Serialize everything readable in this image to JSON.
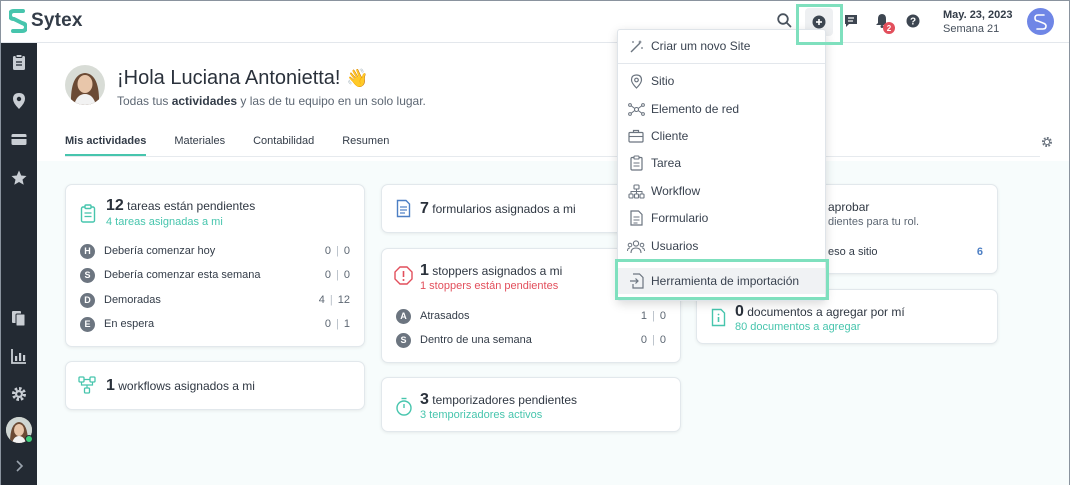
{
  "app": {
    "name": "Sytex"
  },
  "header": {
    "date": "May. 23, 2023",
    "week": "Semana 21",
    "notification_count": "2"
  },
  "greeting": {
    "title": "¡Hola Luciana Antonietta!",
    "emoji": "👋",
    "sub_prefix": "Todas tus ",
    "sub_bold": "actividades",
    "sub_suffix": " y las de tu equipo en un solo lugar."
  },
  "tabs": [
    "Mis actividades",
    "Materiales",
    "Contabilidad",
    "Resumen"
  ],
  "tasks_card": {
    "count": "12",
    "title": "tareas están pendientes",
    "sub": "4 tareas asignadas a mi",
    "rows": [
      {
        "badge": "H",
        "label": "Debería comenzar hoy",
        "a": "0",
        "b": "0"
      },
      {
        "badge": "S",
        "label": "Debería comenzar esta semana",
        "a": "0",
        "b": "0"
      },
      {
        "badge": "D",
        "label": "Demoradas",
        "a": "4",
        "b": "12"
      },
      {
        "badge": "E",
        "label": "En espera",
        "a": "0",
        "b": "1"
      }
    ]
  },
  "workflows_card": {
    "count": "1",
    "title": "workflows asignados a mi"
  },
  "forms_card": {
    "count": "7",
    "title": "formularios asignados a mi"
  },
  "stoppers_card": {
    "count": "1",
    "title": "stoppers asignados a mi",
    "sub": "1 stoppers están pendientes",
    "rows": [
      {
        "badge": "A",
        "label": "Atrasados",
        "a": "1",
        "b": "0"
      },
      {
        "badge": "S",
        "label": "Dentro de una semana",
        "a": "0",
        "b": "0"
      }
    ]
  },
  "timers_card": {
    "count": "3",
    "title": "temporizadores pendientes",
    "sub": "3 temporizadores activos"
  },
  "approve_card": {
    "title_partial": "aprobar",
    "sub_partial": "dientes para tu rol.",
    "row_label_partial": "eso a sitio",
    "row_value": "6"
  },
  "docs_card": {
    "count": "0",
    "title": "documentos a agregar por mí",
    "sub": "80 documentos a agregar"
  },
  "create_menu": {
    "items": [
      {
        "label": "Criar um novo Site",
        "icon": "magic-wand-icon"
      },
      {
        "label": "Sitio",
        "icon": "map-pin-icon"
      },
      {
        "label": "Elemento de red",
        "icon": "network-icon"
      },
      {
        "label": "Cliente",
        "icon": "briefcase-icon"
      },
      {
        "label": "Tarea",
        "icon": "clipboard-icon"
      },
      {
        "label": "Workflow",
        "icon": "workflow-icon"
      },
      {
        "label": "Formulario",
        "icon": "form-icon"
      },
      {
        "label": "Usuarios",
        "icon": "users-icon"
      },
      {
        "label": "Herramienta de importación",
        "icon": "import-file-icon"
      }
    ]
  },
  "colors": {
    "accent": "#47c5ad",
    "sidebar": "#232a33",
    "highlight": "#7fe0be",
    "danger": "#e24f5c"
  }
}
